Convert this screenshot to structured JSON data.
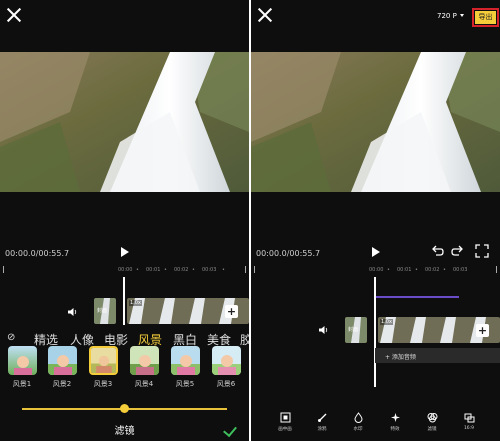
{
  "left": {
    "timecode": "00:00.0/00:55.7",
    "ruler_ticks": [
      "00:00",
      "•",
      "00:01",
      "•",
      "00:02",
      "•",
      "00:03",
      "•"
    ],
    "cover_label": "封面",
    "clip_speed": "1.0x",
    "categories": [
      "精选",
      "人像",
      "电影",
      "风景",
      "黑白",
      "美食",
      "胶"
    ],
    "active_category": "风景",
    "filters": [
      {
        "label": "风景1",
        "selected": false
      },
      {
        "label": "风景2",
        "selected": false
      },
      {
        "label": "风景3",
        "selected": true
      },
      {
        "label": "风景4",
        "selected": false
      },
      {
        "label": "风景5",
        "selected": false
      },
      {
        "label": "风景6",
        "selected": false
      }
    ],
    "intensity": 0.5,
    "panel_title": "滤镜"
  },
  "right": {
    "resolution": "720 P",
    "export_label": "导出",
    "timecode": "00:00.0/00:55.7",
    "ruler_ticks": [
      "00:00",
      "•",
      "00:01",
      "•",
      "00:02",
      "•",
      "00:03"
    ],
    "cover_label": "封面",
    "clip_speed": "1.0x",
    "add_audio": "+ 添加音频",
    "tools": [
      "画中画",
      "涂鸦",
      "水印",
      "特效",
      "滤镜",
      "16:9"
    ],
    "tool_icons": [
      "crop-icon",
      "brush-icon",
      "droplet-icon",
      "sparkle-icon",
      "filter-icon",
      "ratio-icon"
    ]
  },
  "colors": {
    "accent": "#f5cd3a",
    "export_border": "#d4232b",
    "confirm": "#3fbf5c",
    "track_purple": "#6a4cc9"
  }
}
